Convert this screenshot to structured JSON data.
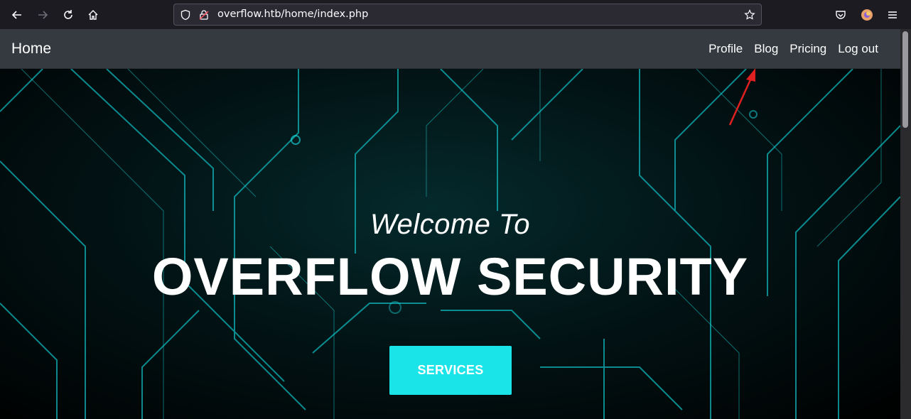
{
  "browser": {
    "url": "overflow.htb/home/index.php",
    "icons": {
      "back": "back-arrow-icon",
      "forward": "forward-arrow-icon",
      "reload": "reload-icon",
      "home": "home-icon",
      "tracking": "shield-icon",
      "lock": "insecure-lock-icon",
      "bookmark": "star-icon",
      "pocket": "pocket-icon",
      "account": "firefox-account-icon",
      "menu": "hamburger-menu-icon"
    }
  },
  "navbar": {
    "brand": "Home",
    "links": [
      "Profile",
      "Blog",
      "Pricing",
      "Log out"
    ]
  },
  "hero": {
    "subtitle": "Welcome To",
    "title": "OVERFLOW SECURITY",
    "button_label": "SERVICES"
  },
  "colors": {
    "navbar_bg": "#343a40",
    "accent": "#1be4e9",
    "annotation": "#e02020"
  }
}
